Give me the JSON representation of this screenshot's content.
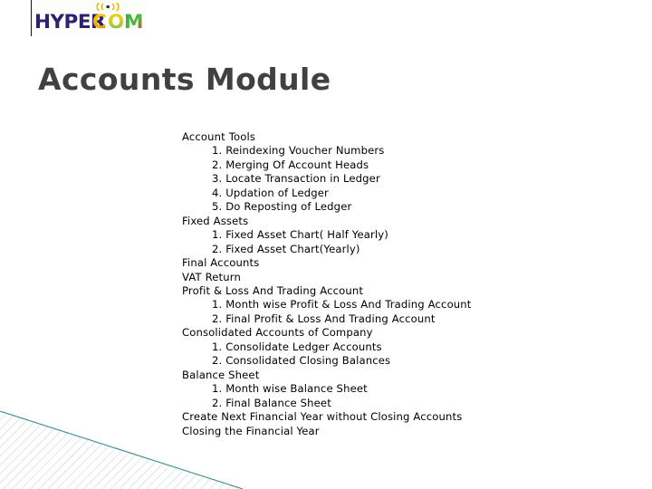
{
  "slide": {
    "title": "Accounts Module",
    "background_color": "#ffffff",
    "title_color": "#414141"
  },
  "logo": {
    "text_primary": "HYPER",
    "text_secondary": "COM",
    "primary_color": "#2e2270",
    "secondary_colors": [
      "#f2c200",
      "#8cc63f",
      "#2aa84a",
      "#e03020"
    ],
    "signal_icon_name": "wireless-signal-icon",
    "signal_icon_color": "#f0b400",
    "background_color": "#fdfdfa",
    "border_color": "#1a1a1a"
  },
  "decoration": {
    "name": "bottom-left-hatched-triangle",
    "edge_color": "#3f8c8c",
    "hatch_color": "#b9c9c9"
  },
  "content": {
    "lines": [
      {
        "level": 1,
        "text": "Account Tools"
      },
      {
        "level": 2,
        "text": "1. Reindexing Voucher Numbers"
      },
      {
        "level": 2,
        "text": "2. Merging Of Account Heads"
      },
      {
        "level": 2,
        "text": "3. Locate Transaction in Ledger"
      },
      {
        "level": 2,
        "text": "4. Updation of Ledger"
      },
      {
        "level": 2,
        "text": "5. Do Reposting of Ledger"
      },
      {
        "level": 1,
        "text": "Fixed Assets"
      },
      {
        "level": 2,
        "text": "1. Fixed Asset Chart( Half Yearly)"
      },
      {
        "level": 2,
        "text": "2. Fixed Asset Chart(Yearly)"
      },
      {
        "level": 1,
        "text": "Final Accounts"
      },
      {
        "level": 1,
        "text": "VAT Return"
      },
      {
        "level": 1,
        "text": "Profit & Loss And Trading Account"
      },
      {
        "level": 2,
        "text": "1. Month wise Profit & Loss And Trading Account"
      },
      {
        "level": 2,
        "text": "2. Final Profit & Loss And Trading Account"
      },
      {
        "level": 1,
        "text": "Consolidated Accounts of Company"
      },
      {
        "level": 2,
        "text": "1. Consolidate Ledger Accounts"
      },
      {
        "level": 2,
        "text": "2. Consolidated Closing Balances"
      },
      {
        "level": 1,
        "text": "Balance Sheet"
      },
      {
        "level": 2,
        "text": "1. Month wise Balance Sheet"
      },
      {
        "level": 2,
        "text": "2. Final Balance Sheet"
      },
      {
        "level": 1,
        "text": "Create Next Financial Year without Closing Accounts"
      },
      {
        "level": 1,
        "text": "Closing the Financial Year"
      }
    ]
  }
}
